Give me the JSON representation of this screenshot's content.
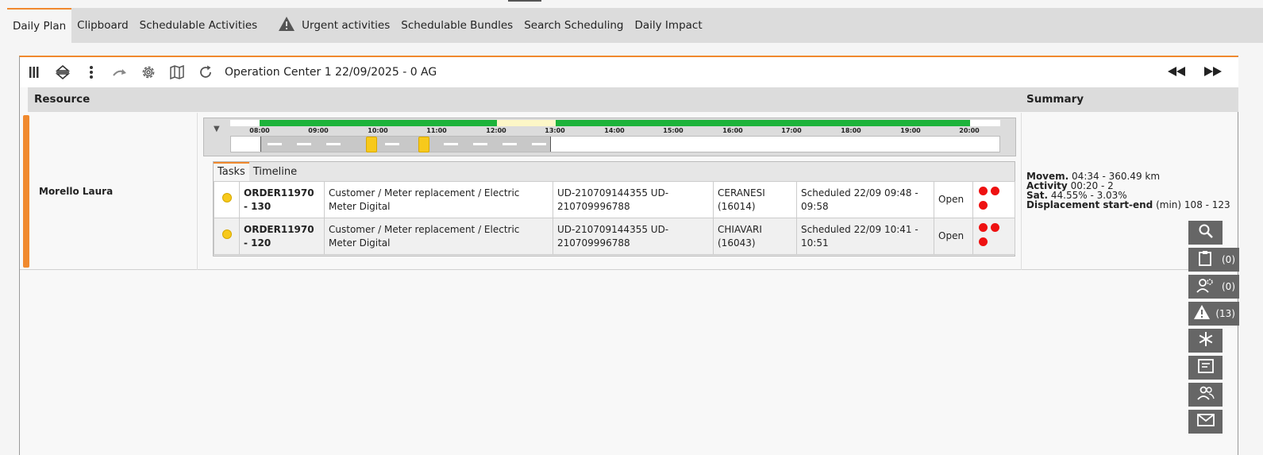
{
  "tabs": [
    {
      "label": "Daily Plan",
      "active": true
    },
    {
      "label": "Clipboard"
    },
    {
      "label": "Schedulable Activities"
    },
    {
      "label": "Urgent activities",
      "icon": "warning-icon"
    },
    {
      "label": "Schedulable Bundles"
    },
    {
      "label": "Search Scheduling"
    },
    {
      "label": "Daily Impact"
    }
  ],
  "toolbar": {
    "title": "Operation Center 1 22/09/2025 - 0 AG",
    "icons": [
      "columns-icon",
      "expand-collapse-icon",
      "more-vertical-icon",
      "redo-icon",
      "gear-icon",
      "map-icon",
      "refresh-icon"
    ],
    "nav": [
      "rewind-icon",
      "fast-forward-icon"
    ]
  },
  "headers": {
    "resource": "Resource",
    "summary": "Summary"
  },
  "resource": {
    "name": "Morello Laura",
    "timeline_ticks": [
      "08:00",
      "09:00",
      "10:00",
      "11:00",
      "12:00",
      "13:00",
      "14:00",
      "15:00",
      "16:00",
      "17:00",
      "18:00",
      "19:00",
      "20:00"
    ],
    "subtabs": [
      "Tasks",
      "Timeline"
    ],
    "tasks": [
      {
        "order": "ORDER11970 - 130",
        "description": "Customer / Meter replacement / Electric Meter Digital",
        "ud": "UD-210709144355 UD-210709996788",
        "location": "CERANESI (16014)",
        "schedule": "Scheduled 22/09 09:48 - 09:58",
        "status": "Open"
      },
      {
        "order": "ORDER11970 - 120",
        "description": "Customer / Meter replacement / Electric Meter Digital",
        "ud": "UD-210709144355 UD-210709996788",
        "location": "CHIAVARI (16043)",
        "schedule": "Scheduled 22/09 10:41 - 10:51",
        "status": "Open"
      }
    ],
    "summary": {
      "movem_label": "Movem.",
      "movem_value": "04:34 - 360.49 km",
      "activity_label": "Activity",
      "activity_value": "00:20 - 2",
      "sat_label": "Sat.",
      "sat_value": "44.55% - 3.03%",
      "displacement_label": "Displacement start-end",
      "displacement_unit": "(min)",
      "displacement_value": "108 - 123"
    }
  },
  "sidebar": [
    {
      "icon": "search-icon",
      "count": ""
    },
    {
      "icon": "clipboard-icon",
      "count": "(0)"
    },
    {
      "icon": "people-gear-icon",
      "count": "(0)"
    },
    {
      "icon": "warning-icon",
      "count": "(13)"
    },
    {
      "icon": "snowflake-icon",
      "count": ""
    },
    {
      "icon": "form-icon",
      "count": ""
    },
    {
      "icon": "team-icon",
      "count": ""
    },
    {
      "icon": "mail-icon",
      "count": ""
    }
  ],
  "colors": {
    "accent": "#f0892e",
    "available": "#1db33a",
    "pending": "#f7c91b",
    "alert": "#ee1111"
  }
}
